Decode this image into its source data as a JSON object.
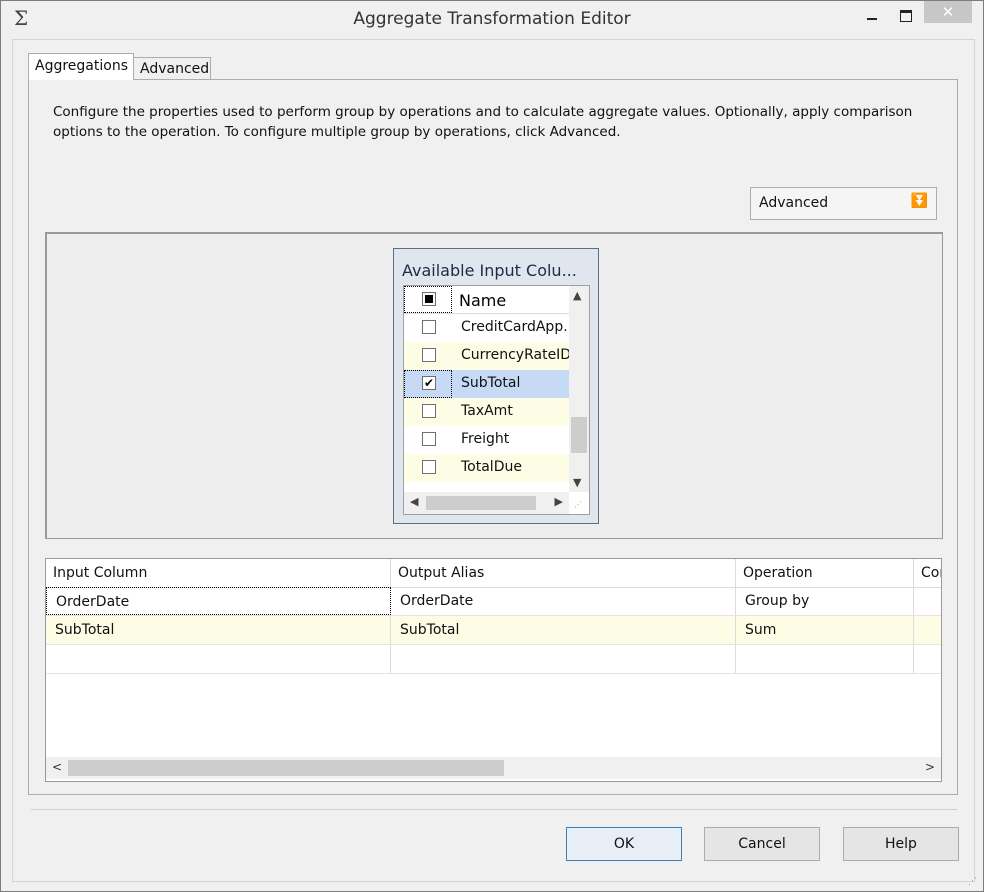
{
  "window": {
    "title": "Aggregate Transformation Editor",
    "icon": "sigma-icon",
    "close_glyph": "✕"
  },
  "tabs": [
    {
      "label": "Aggregations",
      "selected": true
    },
    {
      "label": "Advanced",
      "selected": false
    }
  ],
  "description": "Configure the properties used to perform group by operations and to calculate aggregate values. Optionally, apply comparison options to the operation. To configure multiple group by operations, click Advanced.",
  "advanced_dropdown": {
    "label": "Advanced",
    "arrow": "⏬"
  },
  "available_columns": {
    "title": "Available Input Colu...",
    "header_label": "Name",
    "rows": [
      {
        "label": "CreditCardApp...",
        "checked": false
      },
      {
        "label": "CurrencyRateID",
        "checked": false
      },
      {
        "label": "SubTotal",
        "checked": true
      },
      {
        "label": "TaxAmt",
        "checked": false
      },
      {
        "label": "Freight",
        "checked": false
      },
      {
        "label": "TotalDue",
        "checked": false
      }
    ]
  },
  "grid": {
    "headers": [
      "Input Column",
      "Output Alias",
      "Operation",
      "Cor"
    ],
    "rows": [
      [
        "OrderDate",
        "OrderDate",
        "Group by",
        ""
      ],
      [
        "SubTotal",
        "SubTotal",
        "Sum",
        ""
      ],
      [
        "",
        "",
        "",
        ""
      ]
    ]
  },
  "buttons": {
    "ok": "OK",
    "cancel": "Cancel",
    "help": "Help"
  },
  "colors": {
    "row_alt": "#fcfde4",
    "row_selected": "#c6d9f5",
    "panel_bg": "#dfe6ee"
  }
}
